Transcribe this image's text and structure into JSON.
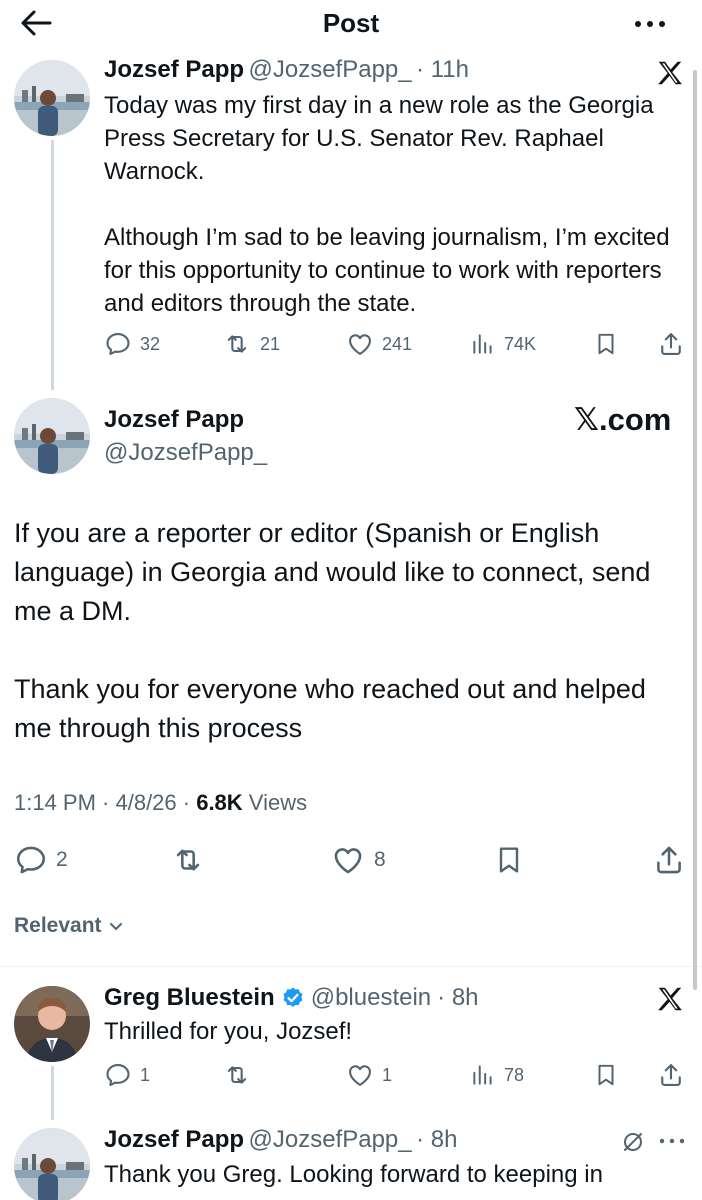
{
  "header": {
    "title": "Post"
  },
  "quoted_post": {
    "author_name": "Jozsef Papp",
    "handle": "@JozsefPapp_",
    "time": "· 11h",
    "text_p1": "Today was my first day in a new role as the Georgia Press Secretary for U.S. Senator Rev. Raphael Warnock.",
    "text_p2": "Although I’m sad to be leaving journalism, I’m excited for this opportunity to continue to work with reporters and editors through the state.",
    "replies": "32",
    "reposts": "21",
    "likes": "241",
    "views": "74K"
  },
  "main_post": {
    "author_name": "Jozsef Papp",
    "handle": "@JozsefPapp_",
    "xcom": "𝕏.com",
    "text_p1": "If you are a reporter or editor (Spanish or English language) in Georgia and would like to connect, send me a DM.",
    "text_p2": "Thank you for everyone who reached out and helped me through this process",
    "time": "1:14 PM · 4/8/26 · ",
    "views_count": "6.8K",
    "views_label": " Views",
    "replies": "2",
    "likes": "8"
  },
  "sort": {
    "label": "Relevant"
  },
  "reply1": {
    "author_name": "Greg Bluestein",
    "handle": "@bluestein",
    "time": "· 8h",
    "text": "Thrilled for you, Jozsef!",
    "replies": "1",
    "likes": "1",
    "views": "78"
  },
  "reply2": {
    "author_name": "Jozsef Papp",
    "handle": "@JozsefPapp_",
    "time": "· 8h",
    "text": "Thank you Greg. Looking forward to keeping in"
  },
  "colors": {
    "verified": "#1d9bf0",
    "muted": "#536471",
    "line": "#cfd9de"
  },
  "icons": [
    "back-arrow-icon",
    "more-icon",
    "x-logo-icon",
    "reply-icon",
    "repost-icon",
    "like-icon",
    "views-icon",
    "bookmark-icon",
    "share-icon",
    "verified-icon",
    "chevron-down-icon",
    "slash-icon"
  ]
}
